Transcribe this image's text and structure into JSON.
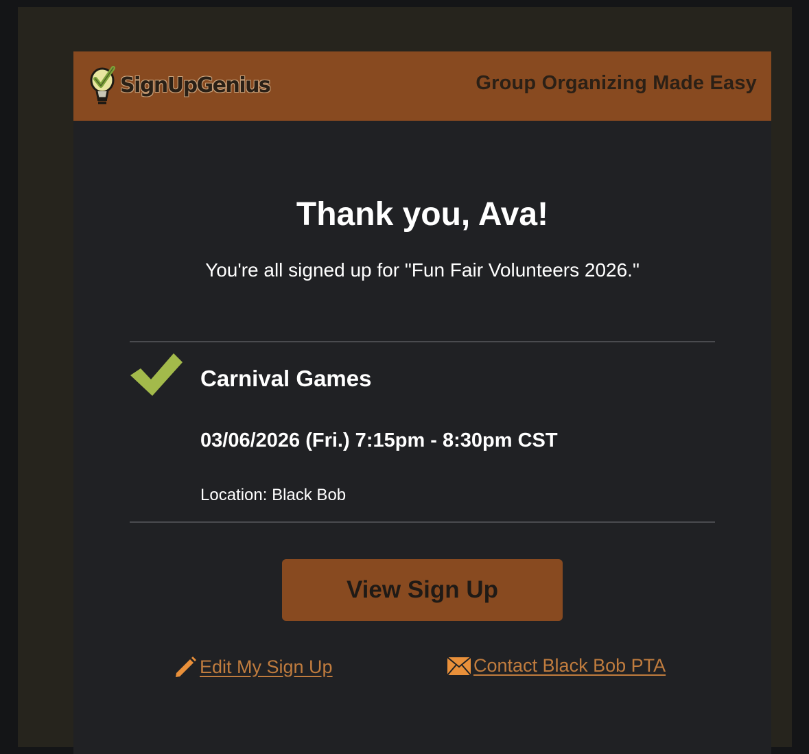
{
  "header": {
    "logo_text": "SignUpGenius",
    "tagline": "Group Organizing Made Easy",
    "bar_color": "#884a20"
  },
  "confirmation": {
    "title": "Thank you, Ava!",
    "subtitle": "You're all signed up for \"Fun Fair Volunteers 2026.\""
  },
  "slot": {
    "check_icon": "check-icon",
    "check_color": "#a3ba4b",
    "name": "Carnival Games",
    "date_time": "03/06/2026 (Fri.) 7:15pm - 8:30pm CST",
    "location": "Location: Black Bob"
  },
  "actions": {
    "view_button_label": "View Sign Up",
    "edit_link": {
      "icon": "pencil-icon",
      "label": "Edit My Sign Up"
    },
    "contact_link": {
      "icon": "envelope-icon",
      "label": "Contact Black Bob PTA"
    },
    "link_color": "#c07c3e"
  }
}
